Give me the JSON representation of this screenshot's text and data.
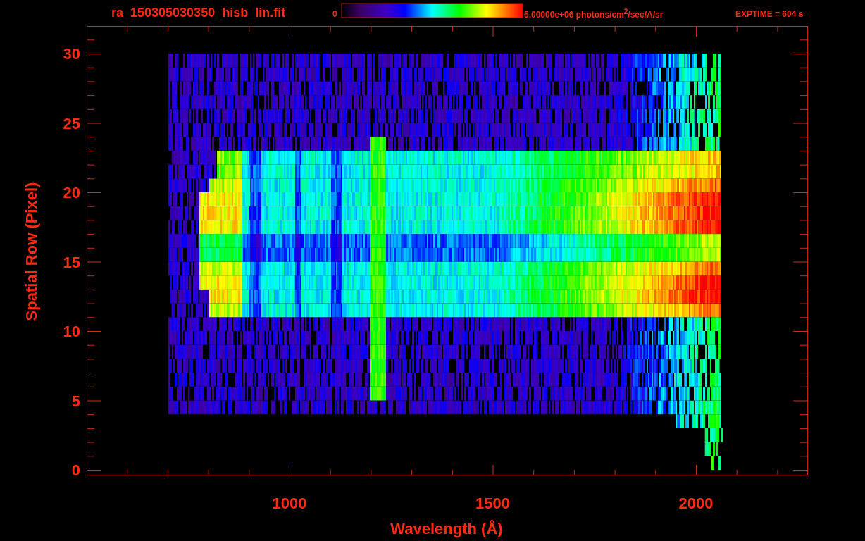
{
  "header": {
    "title": "ra_150305030350_hisb_lin.fit",
    "colorbar_min": "0",
    "colorbar_max": "5.00000e+06 photons/cm$^{2}$/sec/A/sr",
    "exposure": "EXPTIME = 604 s"
  },
  "plot": {
    "x_axis": {
      "title": "Wavelength (Å)",
      "tick_labels": [
        "1000",
        "1500",
        "2000"
      ]
    },
    "y_axis": {
      "title": "Spatial Row (Pixel)",
      "tick_labels": [
        "30",
        "25",
        "20",
        "15",
        "10",
        "5",
        "0"
      ]
    }
  }
}
